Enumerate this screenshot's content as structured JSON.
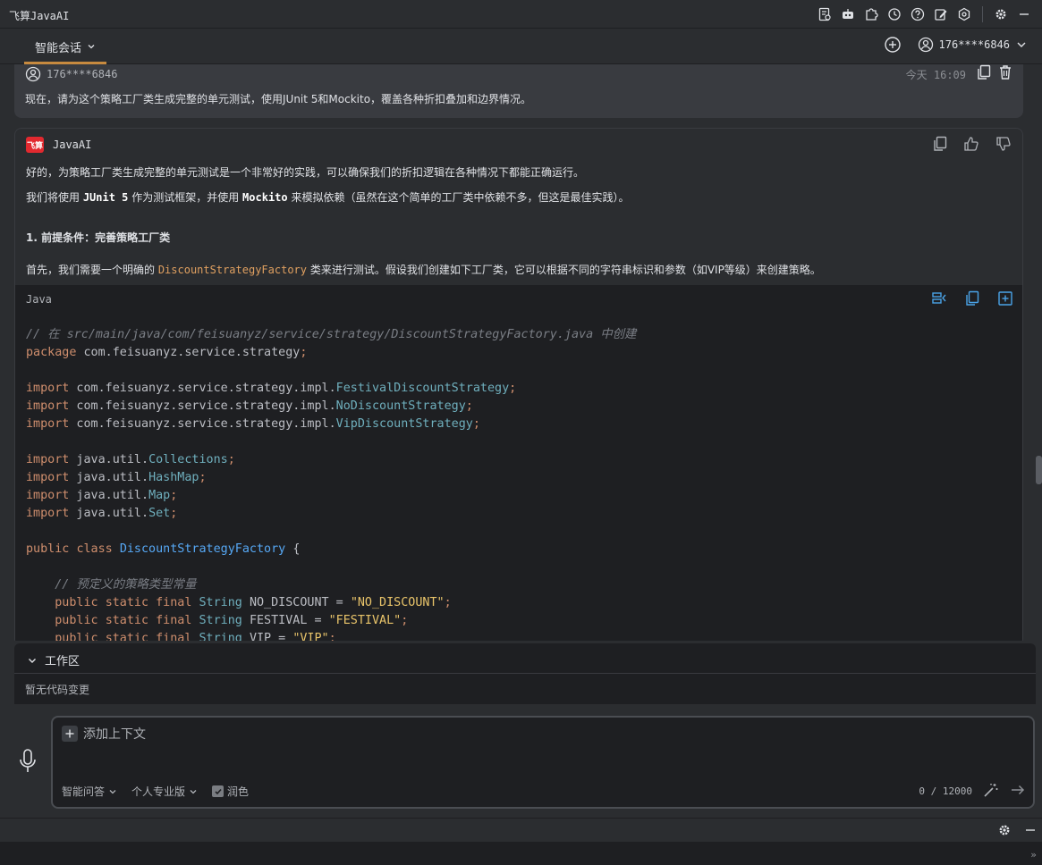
{
  "window": {
    "title": "飞算JavaAI"
  },
  "toolbar_icons": [
    "document-settings-icon",
    "robot-icon",
    "puzzle-icon",
    "history-icon",
    "help-icon",
    "edit-icon",
    "hexagon-settings-icon",
    "gear-icon",
    "minimize-icon"
  ],
  "tabbar": {
    "tab_label": "智能会话",
    "user_label": "176****6846"
  },
  "user_message": {
    "username": "176****6846",
    "time": "今天 16:09",
    "text": "现在，请为这个策略工厂类生成完整的单元测试，使用JUnit 5和Mockito，覆盖各种折扣叠加和边界情况。"
  },
  "ai_message": {
    "logo_text": "飞算",
    "name": "JavaAI",
    "p1": "好的，为策略工厂类生成完整的单元测试是一个非常好的实践，可以确保我们的折扣逻辑在各种情况下都能正确运行。",
    "p2_a": "我们将使用 ",
    "p2_b": "JUnit 5",
    "p2_c": " 作为测试框架，并使用 ",
    "p2_d": "Mockito",
    "p2_e": " 来模拟依赖（虽然在这个简单的工厂类中依赖不多，但这是最佳实践）。",
    "step_title": "1. 前提条件：完善策略工厂类",
    "p3_a": "首先，我们需要一个明确的 ",
    "p3_code": "DiscountStrategyFactory",
    "p3_b": " 类来进行测试。假设我们创建如下工厂类，它可以根据不同的字符串标识和参数（如VIP等级）来创建策略。"
  },
  "code_block": {
    "language": "Java",
    "line1_comment_a": "// 在 ",
    "line1_comment_path": "src/main/java/com/feisuanyz/service/strategy/DiscountStrategyFactory.java",
    "line1_comment_b": " 中创建",
    "kw_package": "package",
    "package_name": " com.feisuanyz.service.strategy",
    "semi": ";",
    "kw_import": "import",
    "imp1_pkg": " com.feisuanyz.service.strategy.impl.",
    "imp1_cls": "FestivalDiscountStrategy",
    "imp2_pkg": " com.feisuanyz.service.strategy.impl.",
    "imp2_cls": "NoDiscountStrategy",
    "imp3_pkg": " com.feisuanyz.service.strategy.impl.",
    "imp3_cls": "VipDiscountStrategy",
    "util_pkg": " java.util.",
    "util1": "Collections",
    "util2": "HashMap",
    "util3": "Map",
    "util4": "Set",
    "kw_public": "public",
    "kw_class": "class",
    "class_name": "DiscountStrategyFactory",
    "brace_open": "{",
    "comment2": "// 预定义的策略类型常量",
    "kw_static": "static",
    "kw_final": "final",
    "type_string": "String",
    "const1": "NO_DISCOUNT",
    "val1": "\"NO_DISCOUNT\"",
    "const2": "FESTIVAL",
    "val2": "\"FESTIVAL\"",
    "const3": "VIP",
    "val3": "\"VIP\"",
    "eq": " = "
  },
  "workarea": {
    "title": "工作区",
    "empty_text": "暂无代码变更"
  },
  "input": {
    "add_context": "添加上下文",
    "mode": "智能问答",
    "edition": "个人专业版",
    "polish_label": "润色",
    "polish_checked": true,
    "counter": "0 / 12000"
  },
  "colors": {
    "accent_tab": "#c78a3f",
    "logo_red": "#e2292f",
    "code_bg": "#1e1f22"
  }
}
